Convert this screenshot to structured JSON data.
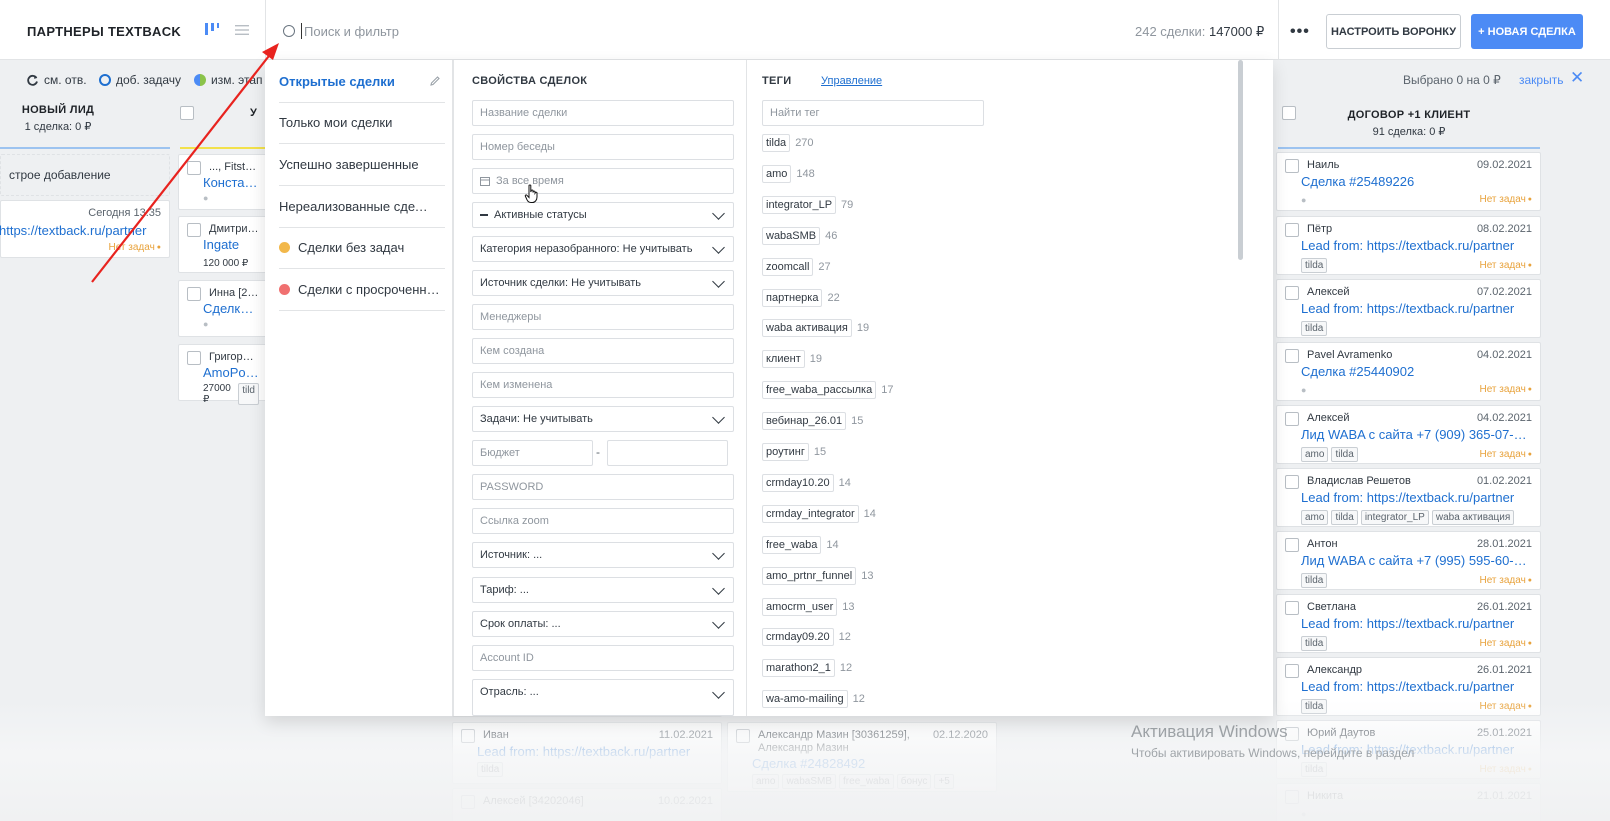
{
  "header": {
    "title": "ПАРТНЕРЫ TEXTBACK",
    "search_placeholder": "Поиск и фильтр",
    "deal_count": "242 сделки:",
    "deal_sum": "147000 ₽",
    "more_label": "•••",
    "funnel_button": "НАСТРОИТЬ ВОРОНКУ",
    "new_deal_button": "+ НОВАЯ СДЕЛКА"
  },
  "actions": {
    "change_resp": "см. отв.",
    "add_task": "доб. задачу",
    "change_stage": "изм. этап",
    "selected": "Выбрано 0 на 0 ₽",
    "close": "закрыть",
    "close_icon": "close-icon"
  },
  "columns": {
    "new_lead": {
      "title": "НОВЫЙ ЛИД",
      "summary": "1 сделка: 0 ₽"
    },
    "second": {
      "title": "У"
    },
    "contract": {
      "title": "ДОГОВОР +1 КЛИЕНТ",
      "summary": "91 сделка: 0 ₽"
    }
  },
  "new_lead_cards": {
    "quick_add": "строе добавление",
    "card": {
      "date": "Сегодня 13:35",
      "link": "https://textback.ru/partner",
      "status": "Нет задач"
    }
  },
  "second_cards": [
    {
      "who": "..., Fitstars",
      "link": "Константин"
    },
    {
      "who": "Дмитрий Аг",
      "link": "Ingate",
      "price": "120 000 ₽"
    },
    {
      "who": "Инна [2892",
      "link": "Сделка #2"
    },
    {
      "who": "Григорий Да",
      "link": "AmoPoint",
      "price": "27000 ₽",
      "tag": "tild"
    }
  ],
  "contract_cards": [
    {
      "who": "Наиль",
      "date": "09.02.2021",
      "link": "Сделка #25489226",
      "tags": [],
      "status": "Нет задач"
    },
    {
      "who": "Пётр",
      "date": "08.02.2021",
      "link": "Lead from: https://textback.ru/partner",
      "tags": [
        "tilda"
      ],
      "status": "Нет задач"
    },
    {
      "who": "Алексей",
      "date": "07.02.2021",
      "link": "Lead from: https://textback.ru/partner",
      "tags": [
        "tilda"
      ],
      "status": ""
    },
    {
      "who": "Pavel Avramenko",
      "date": "04.02.2021",
      "link": "Сделка #25440902",
      "tags": [],
      "status": "Нет задач"
    },
    {
      "who": "Алексей",
      "date": "04.02.2021",
      "link": "Лид WABA с сайта +7 (909) 365-07-03 со...",
      "tags": [
        "amo",
        "tilda"
      ],
      "status": "Нет задач"
    },
    {
      "who": "Владислав Решетов",
      "date": "01.02.2021",
      "link": "Lead from: https://textback.ru/partner",
      "tags": [
        "amo",
        "tilda",
        "integrator_LP",
        "waba активация"
      ],
      "status": ""
    },
    {
      "who": "Антон",
      "date": "28.01.2021",
      "link": "Лид WABA с сайта +7 (995) 595-60-70 со...",
      "tags": [
        "tilda"
      ],
      "status": "Нет задач"
    },
    {
      "who": "Светлана",
      "date": "26.01.2021",
      "link": "Lead from: https://textback.ru/partner",
      "tags": [
        "tilda"
      ],
      "status": "Нет задач"
    },
    {
      "who": "Александр",
      "date": "26.01.2021",
      "link": "Lead from: https://textback.ru/partner",
      "tags": [
        "tilda"
      ],
      "status": "Нет задач"
    },
    {
      "who": "Юрий Даутов",
      "date": "25.01.2021",
      "link": "Lead from: https://textback.ru/partner",
      "tags": [
        "tilda"
      ],
      "status": "Нет задач"
    },
    {
      "who": "Никита",
      "date": "21.01.2021",
      "link": "",
      "tags": [],
      "status": ""
    }
  ],
  "bottom_cards": {
    "tags_row": [
      "amo",
      "tilda"
    ],
    "ivan": {
      "who": "Иван",
      "date": "11.02.2021",
      "link": "Lead from: https://textback.ru/partner",
      "tag": "tilda"
    },
    "alexey": {
      "who": "Алексей [34202046]",
      "date": "10.02.2021"
    },
    "mazin": {
      "who": "Александр Мазин [30361259], Александр Мазин",
      "date": "02.12.2020",
      "link": "Сделка #24828492",
      "tags": [
        "amo",
        "wabaSMB",
        "free_waba",
        "бонус",
        "+5"
      ]
    }
  },
  "filter": {
    "presets": [
      {
        "label": "Открытые сделки",
        "active": true
      },
      {
        "label": "Только мои сделки",
        "active": false
      },
      {
        "label": "Успешно завершенные",
        "active": false
      },
      {
        "label": "Нереализованные сделки",
        "active": false
      },
      {
        "label": "Сделки без задач",
        "dot_color": "#f2b84b"
      },
      {
        "label": "Сделки с просроченным...",
        "dot_color": "#f07070"
      }
    ],
    "props_title": "СВОЙСТВА СДЕЛОК",
    "fields": {
      "deal_name": "Название сделки",
      "chat_number": "Номер беседы",
      "all_time": "За все время",
      "active_statuses": "Активные статусы",
      "category": "Категория неразобранного: Не учитывать",
      "source": "Источник сделки: Не учитывать",
      "managers": "Менеджеры",
      "created_by": "Кем создана",
      "changed_by": "Кем изменена",
      "tasks": "Задачи: Не учитывать",
      "budget": "Бюджет",
      "budget_dash": "-",
      "password": "PASSWORD",
      "zoom": "Ссылка zoom",
      "source2": "Источник: ...",
      "tariff": "Тариф: ...",
      "payment_term": "Срок оплаты: ...",
      "account_id": "Account ID",
      "industry": "Отрасль: ..."
    },
    "tags_title": "ТЕГИ",
    "tags_manage": "Управление",
    "tag_search_placeholder": "Найти тег",
    "tags": [
      {
        "name": "tilda",
        "count": "270"
      },
      {
        "name": "amo",
        "count": "148"
      },
      {
        "name": "integrator_LP",
        "count": "79"
      },
      {
        "name": "wabaSMB",
        "count": "46"
      },
      {
        "name": "zoomcall",
        "count": "27"
      },
      {
        "name": "партнерка",
        "count": "22"
      },
      {
        "name": "waba активация",
        "count": "19"
      },
      {
        "name": "клиент",
        "count": "19"
      },
      {
        "name": "free_waba_рассылка",
        "count": "17"
      },
      {
        "name": "вебинар_26.01",
        "count": "15"
      },
      {
        "name": "роутинг",
        "count": "15"
      },
      {
        "name": "crmday10.20",
        "count": "14"
      },
      {
        "name": "crmday_integrator",
        "count": "14"
      },
      {
        "name": "free_waba",
        "count": "14"
      },
      {
        "name": "amo_prtnr_funnel",
        "count": "13"
      },
      {
        "name": "amocrm_user",
        "count": "13"
      },
      {
        "name": "crmday09.20",
        "count": "12"
      },
      {
        "name": "marathon2_1",
        "count": "12"
      },
      {
        "name": "wa-amo-mailing",
        "count": "12"
      }
    ]
  },
  "os_overlay": {
    "activation_title": "Активация Windows",
    "activation_sub": "Чтобы активировать Windows, перейдите в раздел"
  },
  "colors": {
    "accent": "#4c8bf5",
    "link": "#1e6fd0",
    "no_task": "#e8a33d",
    "arrow": "#e8231f"
  }
}
